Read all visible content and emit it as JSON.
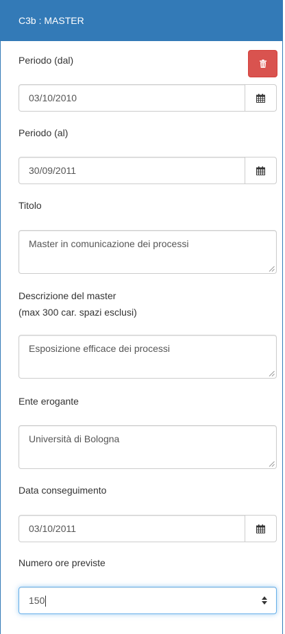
{
  "panel": {
    "title": "C3b : MASTER"
  },
  "fields": {
    "periodo_dal": {
      "label": "Periodo (dal)",
      "value": "03/10/2010"
    },
    "periodo_al": {
      "label": "Periodo (al)",
      "value": "30/09/2011"
    },
    "titolo": {
      "label": "Titolo",
      "value": "Master in comunicazione dei processi"
    },
    "descrizione": {
      "label_line1": "Descrizione del master",
      "label_line2": "(max 300 car. spazi esclusi)",
      "value": "Esposizione efficace dei processi"
    },
    "ente": {
      "label": "Ente erogante",
      "value": "Università di Bologna"
    },
    "data_conseguimento": {
      "label": "Data conseguimento",
      "value": "03/10/2011"
    },
    "ore_previste": {
      "label": "Numero ore previste",
      "value": "150"
    }
  },
  "icons": {
    "delete": "trash-icon",
    "calendar": "calendar-icon",
    "spinner": "spinner-arrows-icon"
  },
  "colors": {
    "header": "#337ab7",
    "danger": "#d9534f",
    "focus": "#66afe9"
  }
}
